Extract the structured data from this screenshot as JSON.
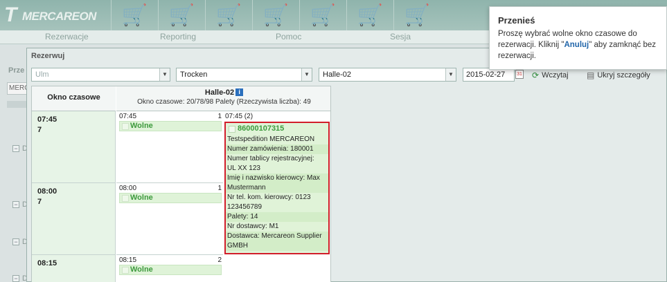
{
  "header": {
    "logo_text": "MERCAREON",
    "menu": [
      "Rezerwacje",
      "Reporting",
      "Pomoc",
      "Sesja"
    ]
  },
  "background": {
    "title": "Prze",
    "input_text": "MERC",
    "rows": [
      "D",
      "D",
      "D",
      "D"
    ]
  },
  "modal": {
    "title": "Rezerwuj",
    "filters": {
      "warehouse_placeholder": "Ulm",
      "type": "Trocken",
      "hall": "Halle-02",
      "extra": "",
      "date": "2015-02-27"
    },
    "actions": {
      "load_label": "Wczytaj",
      "hide_label": "Ukryj szczegóły"
    },
    "grid": {
      "time_header": "Okno czasowe",
      "hall_header": "Halle-02",
      "hall_info": "Okno czasowe: 20/78/98 Palety (Rzeczywista liczba): 49",
      "rows": [
        {
          "time": "07:45",
          "count": "7",
          "slot_time": "07:45",
          "slot_num": "1",
          "status": "Wolne"
        },
        {
          "time": "08:00",
          "count": "7",
          "slot_time": "08:00",
          "slot_num": "1",
          "status": "Wolne"
        },
        {
          "time": "08:15",
          "count": "",
          "slot_time": "08:15",
          "slot_num": "2",
          "status": "Wolne"
        }
      ],
      "booking": {
        "slot_label": "07:45 (2)",
        "id": "86000107315",
        "lines": [
          "Testspedition MERCAREON",
          "Numer zamówienia: 180001",
          "Numer tablicy rejestracyjnej:",
          "UL XX 123",
          "Imię i nazwisko kierowcy: Max",
          "Mustermann",
          "Nr tel. kom. kierowcy: 0123",
          "123456789",
          "Palety: 14",
          "Nr dostawcy: M1",
          "Dostawca: Mercareon Supplier",
          "GMBH"
        ]
      }
    }
  },
  "tooltip": {
    "title": "Przenieś",
    "text_before": "Proszę wybrać wolne okno czasowe do rezerwacji. Kliknij \"",
    "link": "Anuluj",
    "text_after": "\" aby zamknąć bez rezerwacji."
  }
}
